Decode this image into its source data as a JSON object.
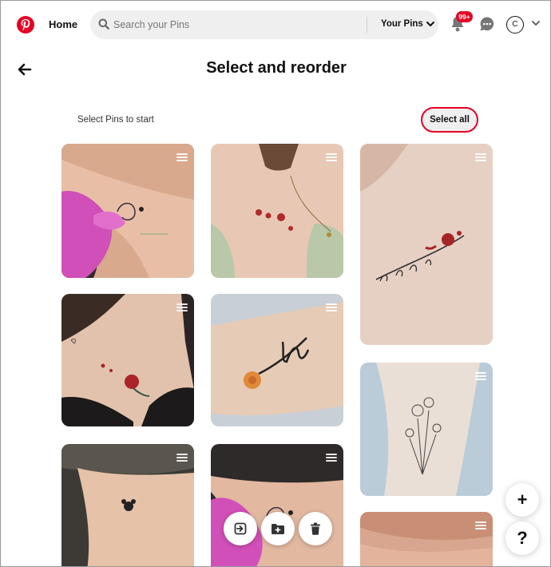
{
  "header": {
    "logo": "pinterest-logo",
    "home_label": "Home",
    "search_placeholder": "Search your Pins",
    "search_scope": "Your Pins",
    "notifications_badge": "99+",
    "account_initial": "C",
    "brand_color": "#e60023"
  },
  "page": {
    "title": "Select and reorder",
    "hint": "Select Pins to start",
    "select_all_label": "Select all"
  },
  "pins": [
    {
      "id": "wrist-heart-paw",
      "column": 1
    },
    {
      "id": "collarbone-roses-necklace",
      "column": 2
    },
    {
      "id": "collarbone-luce-script-rose",
      "column": 3
    },
    {
      "id": "chest-rose",
      "column": 1
    },
    {
      "id": "forearm-luz-flower",
      "column": 2
    },
    {
      "id": "calf-wildflowers",
      "column": 3
    },
    {
      "id": "wrist-panda",
      "column": 1
    },
    {
      "id": "wrist-heart-paw-glove",
      "column": 2
    },
    {
      "id": "skin-partial",
      "column": 3
    }
  ],
  "actions": {
    "icons": [
      "move-icon",
      "add-to-board-icon",
      "trash-icon"
    ]
  },
  "fabs": {
    "create": "+",
    "help": "?"
  }
}
